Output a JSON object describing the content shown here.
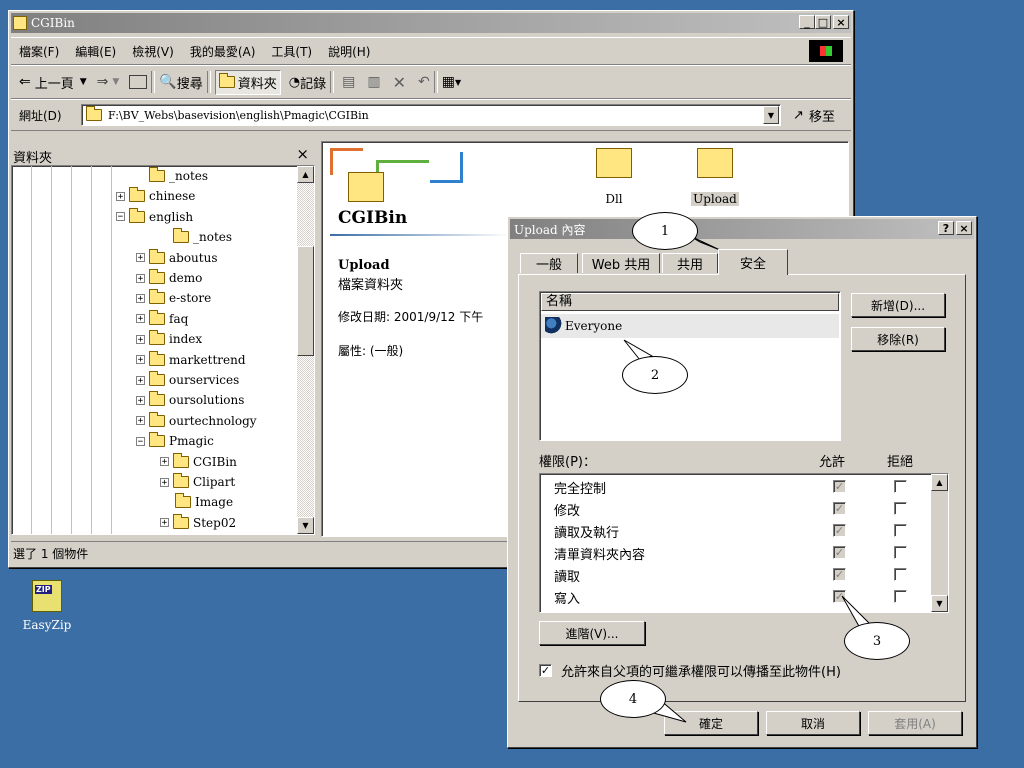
{
  "explorer": {
    "title": "CGIBin",
    "menus": [
      "檔案(F)",
      "編輯(E)",
      "檢視(V)",
      "我的最愛(A)",
      "工具(T)",
      "說明(H)"
    ],
    "toolbar": {
      "back": "上一頁",
      "search": "搜尋",
      "folders": "資料夾",
      "history": "記錄"
    },
    "address_label": "網址(D)",
    "address_value": "F:\\BV_Webs\\basevision\\english\\Pmagic\\CGIBin",
    "go_label": "移至",
    "folder_pane_title": "資料夾",
    "tree": [
      {
        "label": "_notes",
        "indent": 1,
        "pm": ""
      },
      {
        "label": "chinese",
        "indent": 0,
        "pm": "+"
      },
      {
        "label": "english",
        "indent": 0,
        "pm": "−"
      },
      {
        "label": "_notes",
        "indent": 2,
        "pm": ""
      },
      {
        "label": "aboutus",
        "indent": 1,
        "pm": "+"
      },
      {
        "label": "demo",
        "indent": 1,
        "pm": "+"
      },
      {
        "label": "e-store",
        "indent": 1,
        "pm": "+"
      },
      {
        "label": "faq",
        "indent": 1,
        "pm": "+"
      },
      {
        "label": "index",
        "indent": 1,
        "pm": "+"
      },
      {
        "label": "markettrend",
        "indent": 1,
        "pm": "+"
      },
      {
        "label": "ourservices",
        "indent": 1,
        "pm": "+"
      },
      {
        "label": "oursolutions",
        "indent": 1,
        "pm": "+"
      },
      {
        "label": "ourtechnology",
        "indent": 1,
        "pm": "+"
      },
      {
        "label": "Pmagic",
        "indent": 1,
        "pm": "−"
      },
      {
        "label": "CGIBin",
        "indent": 2,
        "pm": "+"
      },
      {
        "label": "Clipart",
        "indent": 2,
        "pm": "+"
      },
      {
        "label": "Image",
        "indent": 3,
        "pm": ""
      },
      {
        "label": "Step02",
        "indent": 2,
        "pm": "+"
      }
    ],
    "content_title": "CGIBin",
    "selected_name": "Upload",
    "selected_type": "檔案資料夾",
    "modified": "修改日期: 2001/9/12 下午",
    "attributes": "屬性: (一般)",
    "files": [
      "Dll",
      "Upload"
    ],
    "status": "選了 1 個物件"
  },
  "desktop": {
    "icon_label": "EasyZip",
    "zip_badge": "ZIP"
  },
  "dialog": {
    "title": "Upload 內容",
    "help": "?",
    "close": "×",
    "tabs": [
      "一般",
      "Web 共用",
      "共用",
      "安全"
    ],
    "names_header": "名稱",
    "names": [
      "Everyone"
    ],
    "add_button": "新增(D)...",
    "remove_button": "移除(R)",
    "permissions_label": "權限(P)：",
    "allow_header": "允許",
    "deny_header": "拒絕",
    "permissions": [
      {
        "name": "完全控制"
      },
      {
        "name": "修改"
      },
      {
        "name": "讀取及執行"
      },
      {
        "name": "清單資料夾內容"
      },
      {
        "name": "讀取"
      },
      {
        "name": "寫入"
      }
    ],
    "advanced_button": "進階(V)...",
    "inherit_text": "允許來自父項的可繼承權限可以傳播至此物件(H)",
    "ok": "確定",
    "cancel": "取消",
    "apply": "套用(A)"
  },
  "callouts": [
    "1",
    "2",
    "3",
    "4"
  ]
}
